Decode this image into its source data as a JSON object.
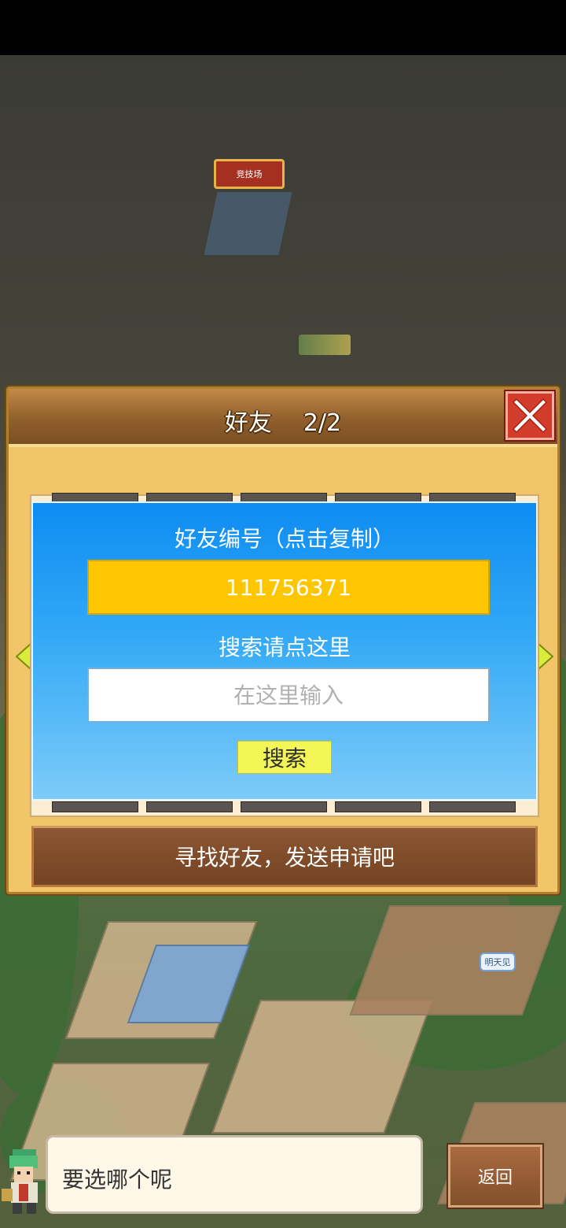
{
  "scene": {
    "arena_label": "竞技场",
    "bye_bubble": "明天见"
  },
  "dialog": {
    "title": "好友",
    "page_count": "2/2",
    "close_icon": "close-x-icon",
    "friend_id_label": "好友编号（点击复制）",
    "friend_id_value": "111756371",
    "search_label": "搜索请点这里",
    "search_placeholder": "在这里输入",
    "search_button": "搜索",
    "find_friends_text": "寻找好友，发送申请吧"
  },
  "chat": {
    "message": "要选哪个呢",
    "back_button": "返回"
  },
  "colors": {
    "panel_blue": "#0d8cf2",
    "id_box_yellow": "#fec600",
    "search_button": "#f4f557",
    "close_red": "#d33c2b"
  }
}
